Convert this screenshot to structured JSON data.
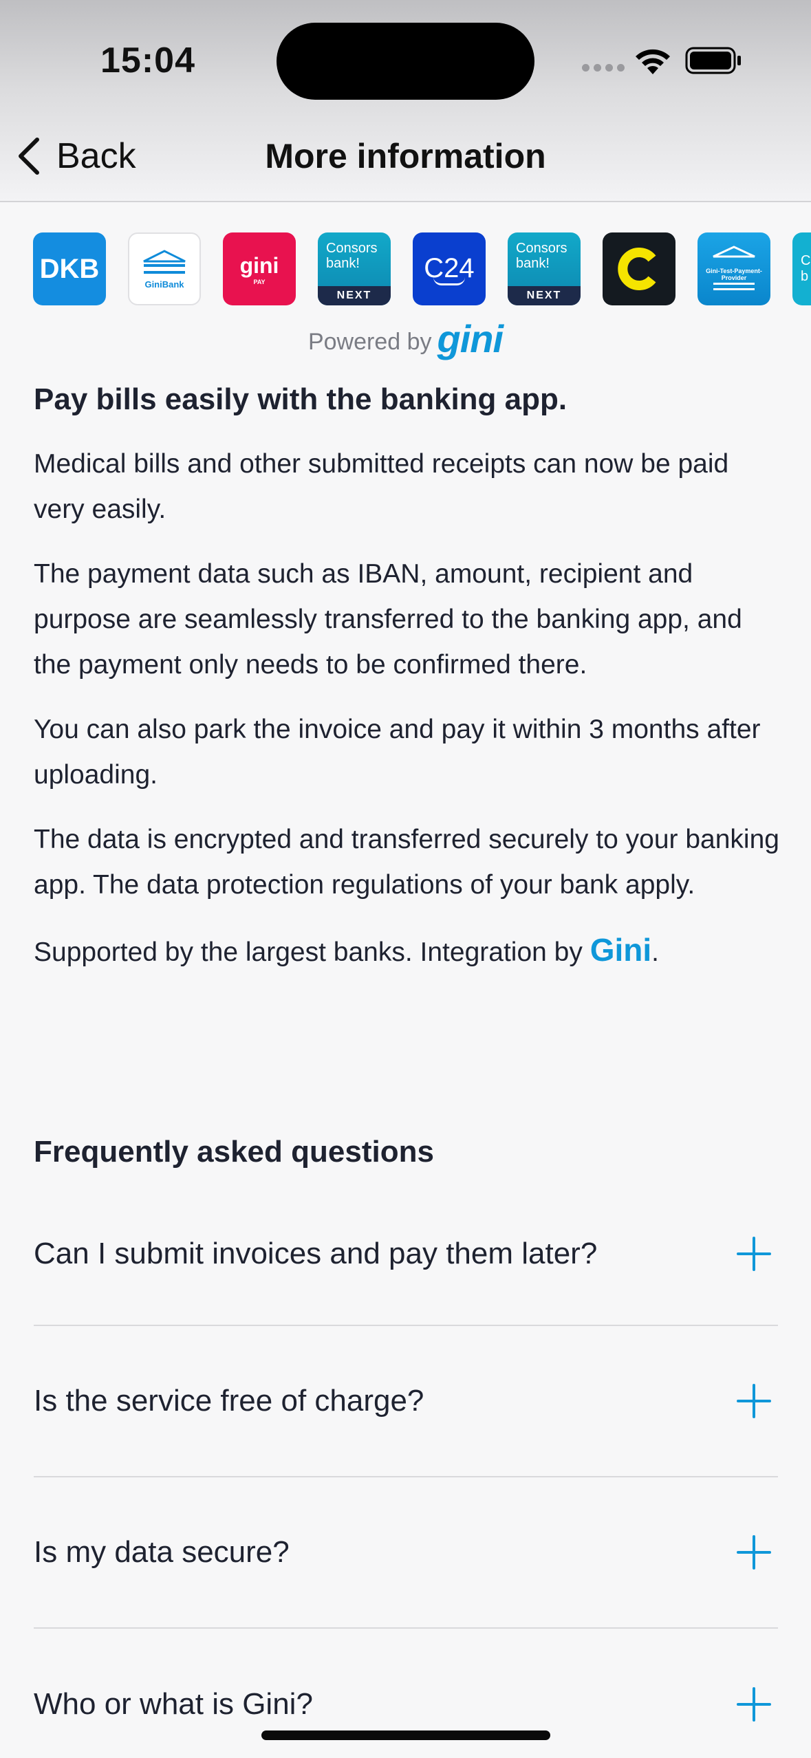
{
  "status_bar": {
    "time": "15:04"
  },
  "nav": {
    "back_label": "Back",
    "title": "More information"
  },
  "banks": [
    {
      "name": "DKB",
      "label": "DKB",
      "color": "#148de0"
    },
    {
      "name": "GiniBank",
      "label": "GiniBank",
      "color": "#ffffff"
    },
    {
      "name": "Gini Pay",
      "label": "gini",
      "sub": "PAY",
      "color": "#e8124f"
    },
    {
      "name": "Consorsbank NEXT",
      "label1": "Consors",
      "label2": "bank!",
      "badge": "NEXT",
      "color": "#12a9c9"
    },
    {
      "name": "C24",
      "label": "C24",
      "color": "#0a3fcf"
    },
    {
      "name": "Consorsbank NEXT 2",
      "label1": "Consors",
      "label2": "bank!",
      "badge": "NEXT",
      "color": "#12a9c9"
    },
    {
      "name": "C",
      "label": "C",
      "color": "#141a20"
    },
    {
      "name": "Gini-Test-Payment-Provider",
      "label": "Gini-Test-Payment-Provider",
      "color": "#1ba4e6"
    },
    {
      "name": "Partial bank",
      "label": "C\nb",
      "color": "#13b0d1"
    }
  ],
  "powered_by": {
    "prefix": "Powered by",
    "brand": "gini"
  },
  "info": {
    "heading": "Pay bills easily with the banking app.",
    "paragraphs": [
      "Medical bills and other submitted receipts can now be paid very easily.",
      "The payment data such as IBAN, amount, recipient and purpose are seamlessly transferred to the banking app, and the payment only needs to be confirmed there.",
      "You can also park the invoice and pay it within 3 months after uploading.",
      "The data is encrypted and transferred securely to your banking app. The data protection regulations of your bank apply."
    ],
    "supported_prefix": "Supported by the largest banks. Integration by ",
    "supported_brand": "Gini",
    "supported_suffix": "."
  },
  "faq": {
    "title": "Frequently asked questions",
    "items": [
      {
        "question": "Can I submit invoices and pay them later?"
      },
      {
        "question": "Is the service free of charge?"
      },
      {
        "question": "Is my data secure?"
      },
      {
        "question": "Who or what is Gini?"
      }
    ]
  },
  "colors": {
    "accent": "#0f97d9",
    "text": "#1e2230",
    "muted": "#7a7c84"
  }
}
